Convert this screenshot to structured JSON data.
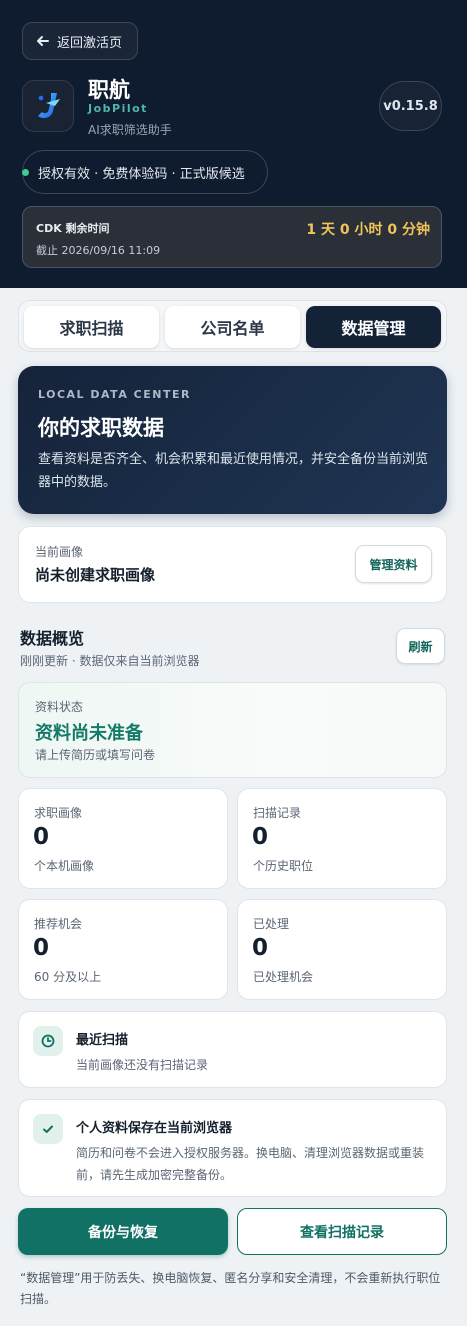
{
  "header": {
    "back_label": "返回激活页",
    "app_name": "职航",
    "app_sub": "JobPilot",
    "app_desc": "AI求职筛选助手",
    "version": "v0.15.8",
    "status": "授权有效 · 免费体验码 · 正式版候选",
    "cdk_label": "CDK 剩余时间",
    "cdk_until": "截止 2026/09/16 11:09",
    "cdk_time": "1 天 0 小时 0 分钟"
  },
  "tabs": [
    {
      "label": "求职扫描",
      "active": false
    },
    {
      "label": "公司名单",
      "active": false
    },
    {
      "label": "数据管理",
      "active": true
    }
  ],
  "hero": {
    "kicker": "LOCAL DATA CENTER",
    "title": "你的求职数据",
    "desc": "查看资料是否齐全、机会积累和最近使用情况，并安全备份当前浏览器中的数据。"
  },
  "profile": {
    "label": "当前画像",
    "value": "尚未创建求职画像",
    "manage_label": "管理资料"
  },
  "overview": {
    "title": "数据概览",
    "sub": "刚刚更新 · 数据仅来自当前浏览器",
    "refresh_label": "刷新"
  },
  "state": {
    "label": "资料状态",
    "value": "资料尚未准备",
    "hint": "请上传简历或填写问卷"
  },
  "stats": [
    {
      "label": "求职画像",
      "value": "0",
      "desc": "个本机画像"
    },
    {
      "label": "扫描记录",
      "value": "0",
      "desc": "个历史职位"
    },
    {
      "label": "推荐机会",
      "value": "0",
      "desc": "60 分及以上"
    },
    {
      "label": "已处理",
      "value": "0",
      "desc": "已处理机会"
    }
  ],
  "recent": {
    "title": "最近扫描",
    "desc": "当前画像还没有扫描记录"
  },
  "privacy": {
    "title": "个人资料保存在当前浏览器",
    "desc": "简历和问卷不会进入授权服务器。换电脑、清理浏览器数据或重装前，请先生成加密完整备份。"
  },
  "actions": {
    "backup_label": "备份与恢复",
    "records_label": "查看扫描记录"
  },
  "footnote": "“数据管理”用于防丢失、换电脑恢复、匿名分享和安全清理，不会重新执行职位扫描。",
  "colors": {
    "header_bg": "#0f1b2e",
    "accent": "#127165",
    "status_green": "#3ccf8e",
    "cdk_time": "#f1c45a"
  }
}
